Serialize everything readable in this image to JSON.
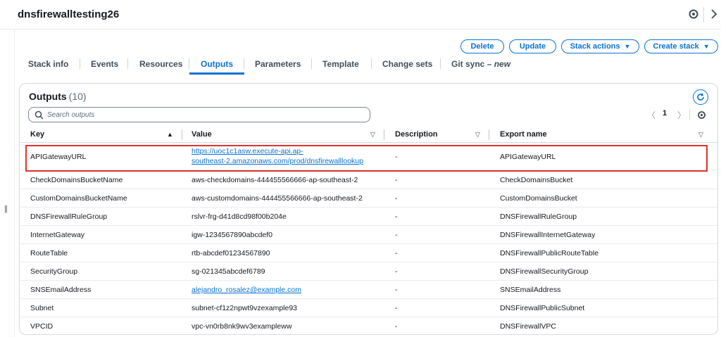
{
  "header": {
    "title": "dnsfirewalltesting26"
  },
  "actions": {
    "delete": "Delete",
    "update": "Update",
    "stack_actions": "Stack actions",
    "create_stack": "Create stack"
  },
  "tabs": [
    {
      "label": "Stack info"
    },
    {
      "label": "Events"
    },
    {
      "label": "Resources"
    },
    {
      "label": "Outputs"
    },
    {
      "label": "Parameters"
    },
    {
      "label": "Template"
    },
    {
      "label": "Change sets"
    },
    {
      "label": "Git sync",
      "dash": " – ",
      "badge": "new"
    }
  ],
  "active_tab": "Outputs",
  "outputs": {
    "title": "Outputs",
    "count": "(10)",
    "search_placeholder": "Search outputs",
    "page": "1",
    "columns": [
      "Key",
      "Value",
      "Description",
      "Export name"
    ],
    "rows": [
      {
        "key": "APIGatewayURL",
        "value": "https://uoc1c1asw.execute-api.ap-southeast-2.amazonaws.com/prod/dnsfirewalllookup",
        "value_line1": "https://uoc1c1asw.execute-api.ap-",
        "value_line2": "southeast-2.amazonaws.com/prod/dnsfirewalllookup",
        "description": "-",
        "export": "APIGatewayURL",
        "is_link": true,
        "highlighted": true
      },
      {
        "key": "CheckDomainsBucketName",
        "value": "aws-checkdomains-444455566666-ap-southeast-2",
        "description": "-",
        "export": "CheckDomainsBucket"
      },
      {
        "key": "CustomDomainsBucketName",
        "value": "aws-customdomains-444455566666-ap-southeast-2",
        "description": "-",
        "export": "CustomDomainsBucket"
      },
      {
        "key": "DNSFirewallRuleGroup",
        "value": "rslvr-frg-d41d8cd98f00b204e",
        "description": "-",
        "export": "DNSFirewallRuleGroup"
      },
      {
        "key": "InternetGateway",
        "value": "igw-1234567890abcdef0",
        "description": "-",
        "export": "DNSFirewallInternetGateway"
      },
      {
        "key": "RouteTable",
        "value": "rtb-abcdef01234567890",
        "description": "-",
        "export": "DNSFirewallPublicRouteTable"
      },
      {
        "key": "SecurityGroup",
        "value": "sg-021345abcdef6789",
        "description": "-",
        "export": "DNSFirewallSecurityGroup"
      },
      {
        "key": "SNSEmailAddress",
        "value": "alejandro_rosalez@example.com",
        "description": "-",
        "export": "SNSEmailAddress",
        "is_link": true
      },
      {
        "key": "Subnet",
        "value": "subnet-cf1z2npwt9vzexample93",
        "description": "-",
        "export": "DNSFirewallPublicSubnet"
      },
      {
        "key": "VPCID",
        "value": "vpc-vn0rb8nk9wv3exampleww",
        "description": "-",
        "export": "DNSFirewallVPC"
      }
    ]
  },
  "colors": {
    "accent": "#0972d3",
    "highlight": "#e0332f"
  }
}
